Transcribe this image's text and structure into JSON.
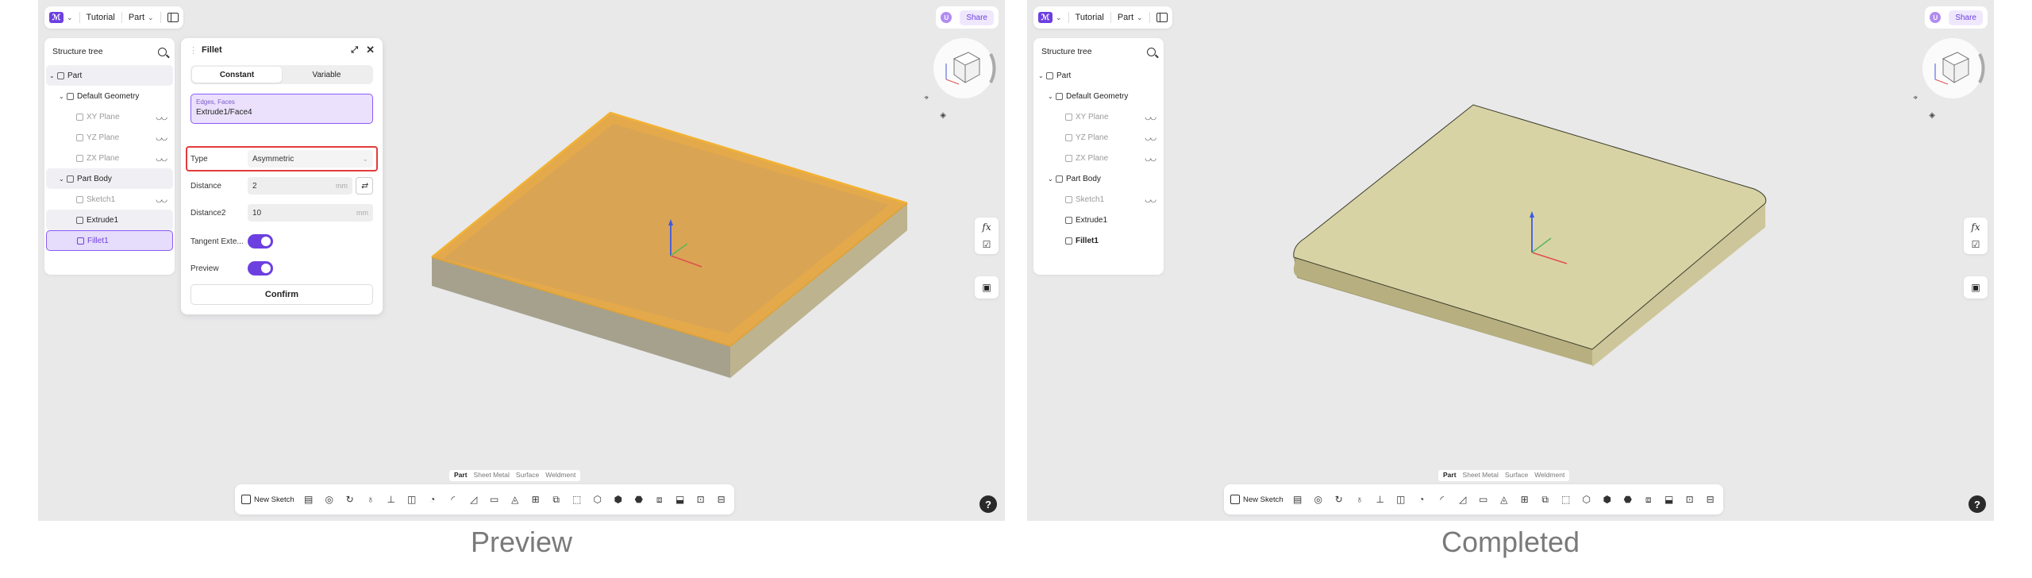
{
  "topbar": {
    "project": "Tutorial",
    "doc": "Part"
  },
  "share": {
    "label": "Share",
    "user_initial": "U"
  },
  "tree": {
    "title": "Structure tree",
    "left_items": [
      {
        "label": "Part",
        "level": 0,
        "caret": "⌄",
        "eye": false,
        "state": "hl"
      },
      {
        "label": "Default Geometry",
        "level": 1,
        "caret": "⌄",
        "eye": false,
        "state": ""
      },
      {
        "label": "XY Plane",
        "level": 2,
        "caret": "",
        "eye": true,
        "state": "dim"
      },
      {
        "label": "YZ Plane",
        "level": 2,
        "caret": "",
        "eye": true,
        "state": "dim"
      },
      {
        "label": "ZX Plane",
        "level": 2,
        "caret": "",
        "eye": true,
        "state": "dim"
      },
      {
        "label": "Part Body",
        "level": 1,
        "caret": "⌄",
        "eye": false,
        "state": "hl"
      },
      {
        "label": "Sketch1",
        "level": 2,
        "caret": "",
        "eye": true,
        "state": "dim"
      },
      {
        "label": "Extrude1",
        "level": 2,
        "caret": "",
        "eye": false,
        "state": "hl"
      },
      {
        "label": "Fillet1",
        "level": 2,
        "caret": "",
        "eye": false,
        "state": "sel"
      }
    ],
    "right_items": [
      {
        "label": "Part",
        "level": 0,
        "caret": "⌄",
        "eye": false,
        "state": ""
      },
      {
        "label": "Default Geometry",
        "level": 1,
        "caret": "⌄",
        "eye": false,
        "state": ""
      },
      {
        "label": "XY Plane",
        "level": 2,
        "caret": "",
        "eye": true,
        "state": "dim"
      },
      {
        "label": "YZ Plane",
        "level": 2,
        "caret": "",
        "eye": true,
        "state": "dim"
      },
      {
        "label": "ZX Plane",
        "level": 2,
        "caret": "",
        "eye": true,
        "state": "dim"
      },
      {
        "label": "Part Body",
        "level": 1,
        "caret": "⌄",
        "eye": false,
        "state": ""
      },
      {
        "label": "Sketch1",
        "level": 2,
        "caret": "",
        "eye": true,
        "state": "dim"
      },
      {
        "label": "Extrude1",
        "level": 2,
        "caret": "",
        "eye": false,
        "state": ""
      },
      {
        "label": "Fillet1",
        "level": 2,
        "caret": "",
        "eye": false,
        "state": "bold"
      }
    ]
  },
  "fillet": {
    "title": "Fillet",
    "tab_constant": "Constant",
    "tab_variable": "Variable",
    "selection_label": "Edges, Faces",
    "selection_value": "Extrude1/Face4",
    "type_label": "Type",
    "type_value": "Asymmetric",
    "distance_label": "Distance",
    "distance_value": "2",
    "distance_unit": "mm",
    "distance2_label": "Distance2",
    "distance2_value": "10",
    "distance2_unit": "mm",
    "tangent_label": "Tangent Exte...",
    "preview_label": "Preview",
    "confirm_label": "Confirm"
  },
  "mode_tabs": [
    "Part",
    "Sheet Metal",
    "Surface",
    "Weldment"
  ],
  "toolbar": {
    "new_sketch": "New Sketch"
  },
  "right_tools": {
    "fx": "fx"
  },
  "captions": {
    "left": "Preview",
    "right": "Completed"
  },
  "colors": {
    "accent": "#6c3fe0",
    "highlight_box": "#e23c3c",
    "preview_face": "#e3a23a",
    "completed_face": "#d8d3a5"
  }
}
